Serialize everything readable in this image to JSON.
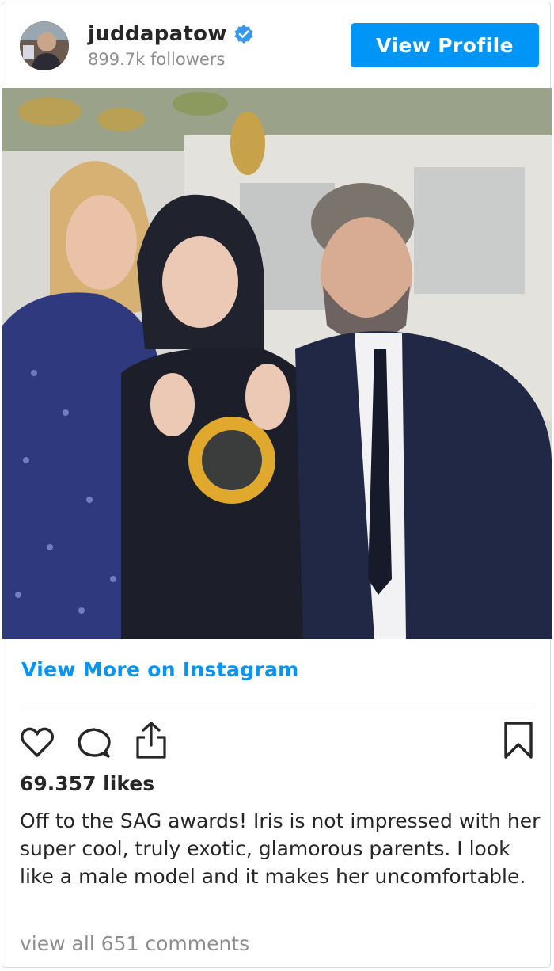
{
  "header": {
    "username": "juddapatow",
    "followers": "899.7k followers",
    "view_profile_label": "View Profile",
    "verified_icon": "verified-badge-icon"
  },
  "post": {
    "view_more_label": "View More on Instagram",
    "likes": "69.357 likes",
    "caption": "Off to the SAG awards! Iris is not impressed with her super cool, truly exotic, glamorous parents. I look like a male model and it makes her uncomfortable.",
    "comments_link": "view all 651 comments"
  },
  "actions": {
    "icons": [
      "heart-icon",
      "comment-icon",
      "share-icon",
      "bookmark-icon"
    ]
  },
  "colors": {
    "accent": "#0095f6",
    "text": "#262626",
    "muted": "#8e8e8e"
  }
}
